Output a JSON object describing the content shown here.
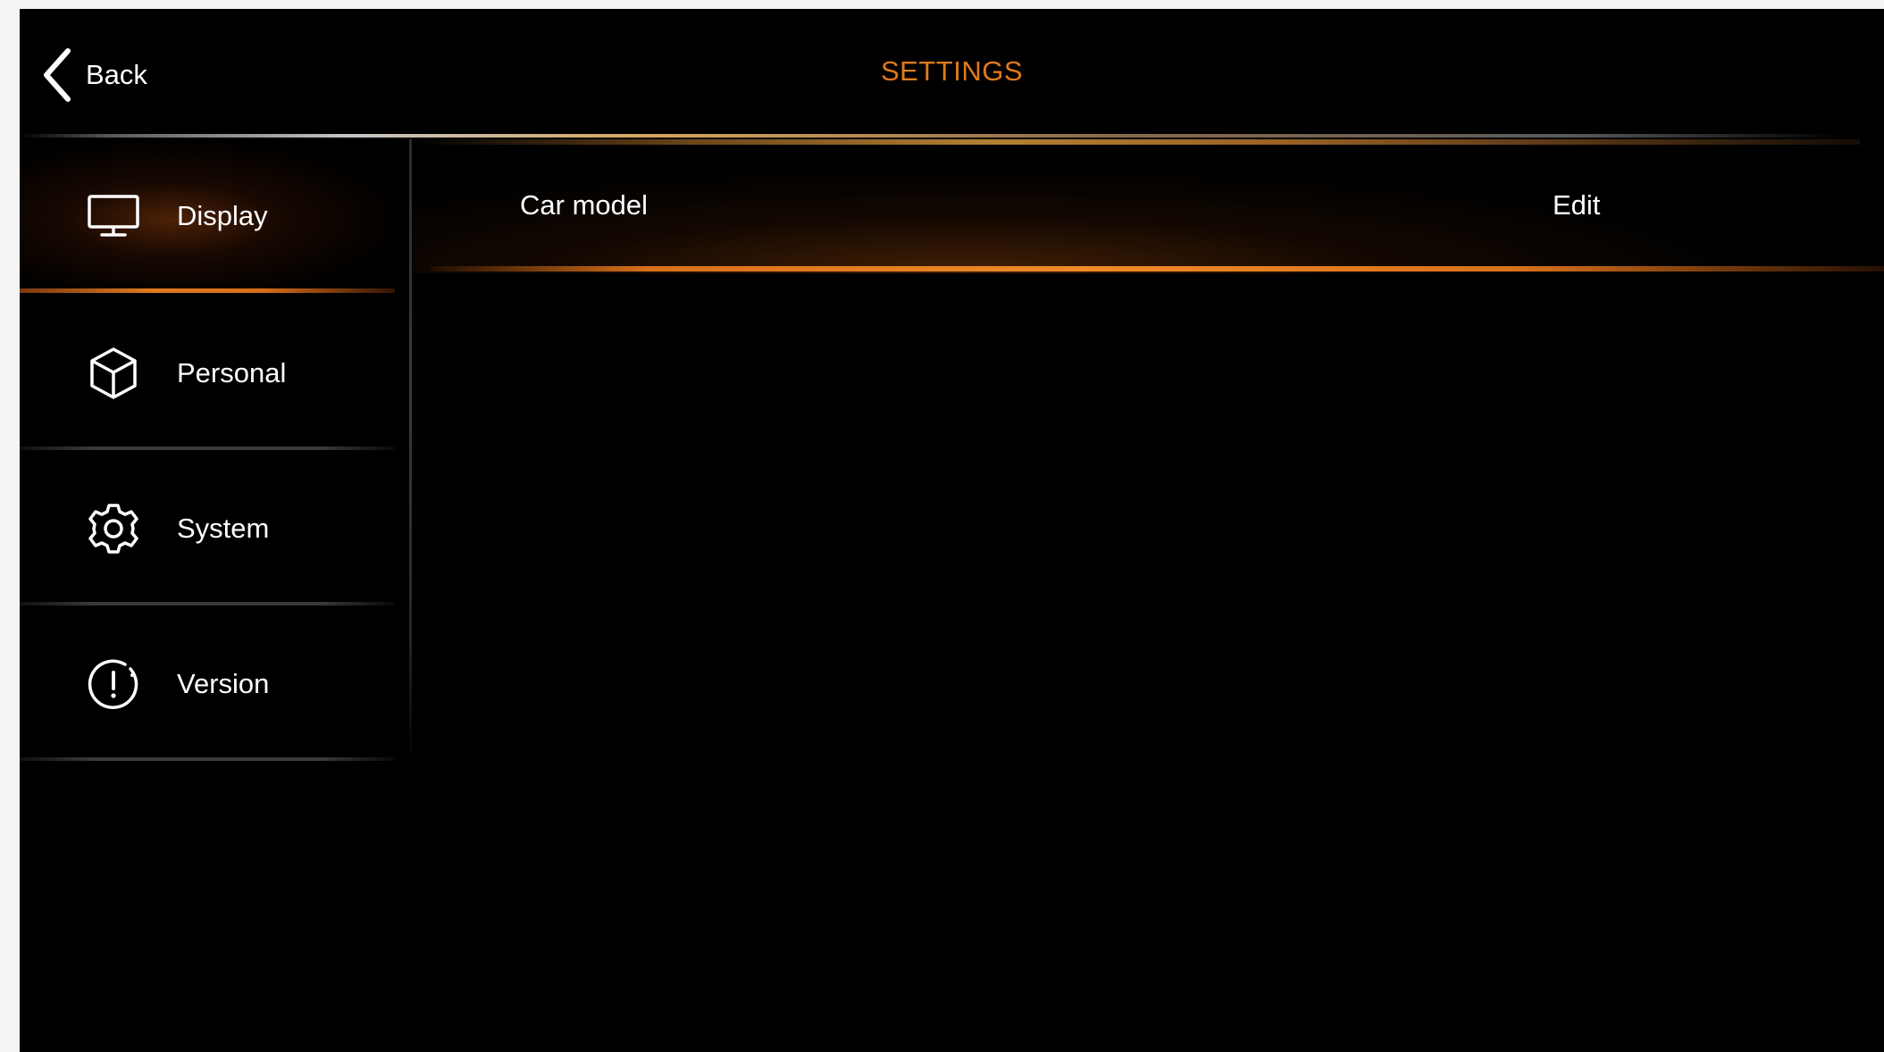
{
  "header": {
    "back_label": "Back",
    "title": "SETTINGS"
  },
  "sidebar": {
    "items": [
      {
        "label": "Display",
        "icon": "monitor-icon",
        "active": true
      },
      {
        "label": "Personal",
        "icon": "cube-icon",
        "active": false
      },
      {
        "label": "System",
        "icon": "gear-icon",
        "active": false
      },
      {
        "label": "Version",
        "icon": "info-icon",
        "active": false
      }
    ]
  },
  "main": {
    "rows": [
      {
        "label": "Car model",
        "action": "Edit"
      }
    ]
  },
  "colors": {
    "accent": "#e07a1c",
    "background": "#000000",
    "text": "#ffffff"
  }
}
